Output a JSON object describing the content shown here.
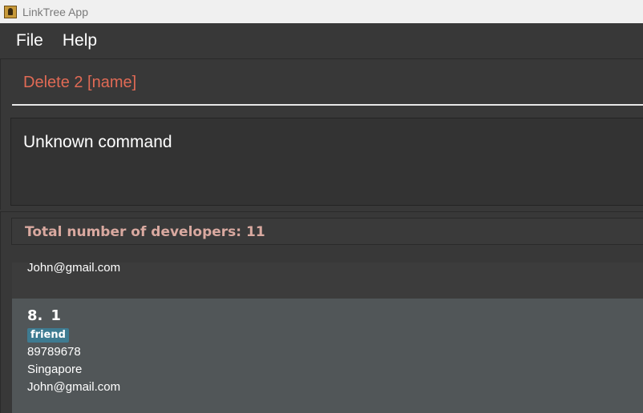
{
  "window": {
    "title": "LinkTree App"
  },
  "menu": {
    "items": [
      "File",
      "Help"
    ]
  },
  "command_box": {
    "value": "Delete 2 [name]"
  },
  "result_display": {
    "text": "Unknown command"
  },
  "developer_list": {
    "header": "Total number of developers: 11",
    "previous_card_email": "John@gmail.com",
    "current_card": {
      "index": "8.",
      "name": "1",
      "tag": "friend",
      "phone": "89789678",
      "address": "Singapore",
      "email": "John@gmail.com"
    }
  },
  "colors": {
    "command_text": "#e06a55",
    "header_text": "#d9a9a0",
    "tag_bg": "#3e7b91",
    "selected_card_bg": "#515658"
  },
  "icons": {
    "app": "app-icon"
  }
}
